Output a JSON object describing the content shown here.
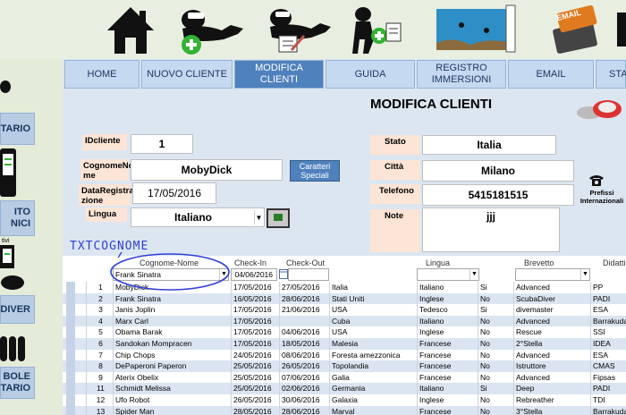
{
  "tabs": [
    "HOME",
    "NUOVO CLIENTE",
    "MODIFICA\nCLIENTI",
    "GUIDA",
    "REGISTRO\nIMMERSIONI",
    "EMAIL",
    "STA"
  ],
  "active_tab": 2,
  "sidebar": {
    "buttons": [
      "TARIO",
      "ITO\nNICI",
      "DIVER",
      "BOLE\nTARIO"
    ],
    "fragment_text": "tivi"
  },
  "top_icons": [
    "home-icon",
    "add-diver-icon",
    "edit-diver-icon",
    "guide-diver-icon",
    "dive-log-icon",
    "email-icon"
  ],
  "email_icon_text": "EMAIL",
  "form": {
    "title": "MODIFICA CLIENTI",
    "idcliente_label": "IDcliente",
    "idcliente_value": "1",
    "cognomenome_label": "CognomeNo\nme",
    "cognomenome_value": "MobyDick",
    "caratteri_button": "Caratteri\nSpeciali",
    "dataregistrazione_label": "DataRegistra\nzione",
    "dataregistrazione_value": "17/05/2016",
    "lingua_label": "Lingua",
    "lingua_value": "Italiano",
    "stato_label": "Stato",
    "stato_value": "Italia",
    "citta_label": "Città",
    "citta_value": "Milano",
    "telefono_label": "Telefono",
    "telefono_value": "5415181515",
    "note_label": "Note",
    "note_value": "jjj",
    "prefissi_label": "Prefissi\nInternazionali"
  },
  "annotation": "TXTCOGNOME",
  "table": {
    "headers": [
      "Cognome-Nome",
      "Check-In",
      "Check-Out",
      "Lingua",
      "Brevetto",
      "Didatti"
    ],
    "filter_values": {
      "cognome": "Frank Sinatra",
      "checkin": "04/06/2016"
    },
    "rows": [
      [
        "1",
        "MobyDick",
        "17/05/2016",
        "27/05/2016",
        "Italia",
        "Italiano",
        "Si",
        "Advanced",
        "PP"
      ],
      [
        "2",
        "Frank Sinatra",
        "16/05/2016",
        "28/06/2016",
        "Stati Uniti",
        "Inglese",
        "No",
        "ScubaDiver",
        "PADI"
      ],
      [
        "3",
        "Janis Joplin",
        "17/05/2016",
        "21/06/2016",
        "USA",
        "Tedesco",
        "Si",
        "divemaster",
        "ESA"
      ],
      [
        "4",
        "Marx Carl",
        "17/05/2016",
        "",
        "Cuba",
        "Italiano",
        "No",
        "Advanced",
        "Barrakuda"
      ],
      [
        "5",
        "Obama Barak",
        "17/05/2016",
        "04/06/2016",
        "USA",
        "Inglese",
        "No",
        "Rescue",
        "SSI"
      ],
      [
        "6",
        "Sandokan Mompracen",
        "17/05/2016",
        "18/05/2016",
        "Malesia",
        "Francese",
        "No",
        "2°Stella",
        "IDEA"
      ],
      [
        "7",
        "Chip Chops",
        "24/05/2016",
        "08/06/2016",
        "Foresta amezzonica",
        "Francese",
        "No",
        "Advanced",
        "ESA"
      ],
      [
        "8",
        "DePaperoni Paperon",
        "25/05/2016",
        "26/05/2016",
        "Topolandia",
        "Francese",
        "No",
        "Istruttore",
        "CMAS"
      ],
      [
        "9",
        "Aterix Obelix",
        "25/05/2016",
        "07/06/2016",
        "Galia",
        "Francese",
        "No",
        "Advanced",
        "Fipsas"
      ],
      [
        "11",
        "Schmidt Melissa",
        "25/05/2016",
        "02/06/2016",
        "Germania",
        "Italiano",
        "Si",
        "Deep",
        "PADI"
      ],
      [
        "12",
        "Ufo Robot",
        "26/05/2016",
        "30/06/2016",
        "Galaxia",
        "Inglese",
        "No",
        "Rebreather",
        "TDI"
      ],
      [
        "13",
        "Spider Man",
        "28/05/2016",
        "28/06/2016",
        "Marval",
        "Francese",
        "No",
        "3°Stella",
        "Barrakuda"
      ]
    ]
  },
  "colors": {
    "tab_active": "#4f81bd",
    "label_bg": "#fce4d6",
    "form_bg": "#dce6f1",
    "annotation": "#2f3fd6"
  }
}
